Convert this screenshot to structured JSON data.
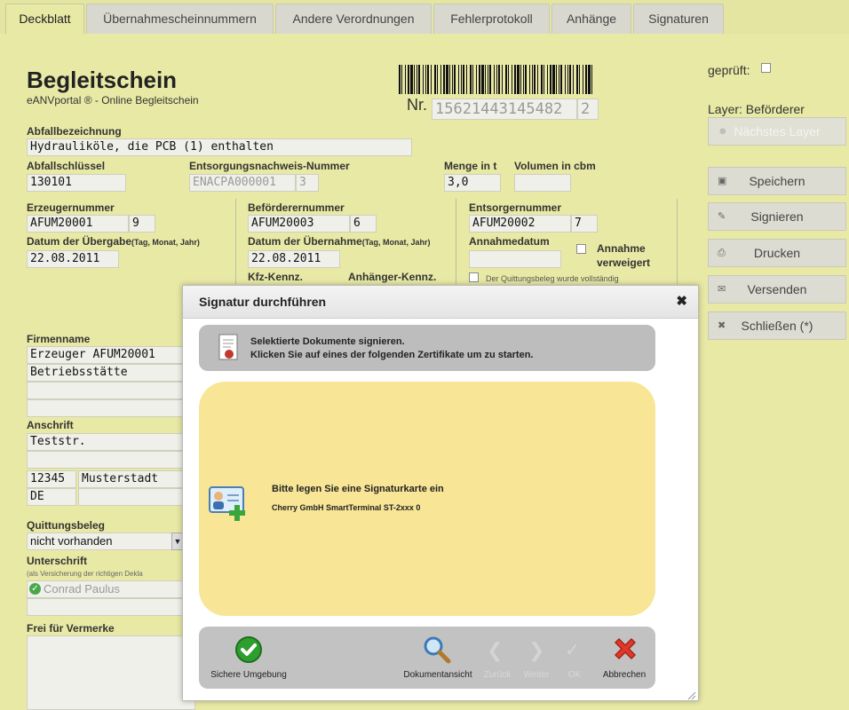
{
  "tabs": [
    "Deckblatt",
    "Übernahmescheinnummern",
    "Andere Verordnungen",
    "Fehlerprotokoll",
    "Anhänge",
    "Signaturen"
  ],
  "header": {
    "title": "Begleitschein",
    "subtitle": "eANVportal ® - Online Begleitschein",
    "nr_label": "Nr.",
    "nr_value": "15621443145482",
    "nr_suffix": "2"
  },
  "right": {
    "geprueft_label": "geprüft:",
    "layer_label": "Layer: Beförderer",
    "next_layer": "Nächstes Layer",
    "buttons": [
      "Speichern",
      "Signieren",
      "Drucken",
      "Versenden",
      "Schließen (*)"
    ]
  },
  "form": {
    "abfall_label": "Abfallbezeichnung",
    "abfall_value": "Hydrauliköle, die PCB (1) enthalten",
    "schluessel_label": "Abfallschlüssel",
    "schluessel_value": "130101",
    "nachweis_label": "Entsorgungsnachweis-Nummer",
    "nachweis_value": "ENACPA000001",
    "nachweis_suffix": "3",
    "menge_label": "Menge in t",
    "menge_value": "3,0",
    "volumen_label": "Volumen in cbm",
    "volumen_value": "",
    "erzeuger_label": "Erzeugernummer",
    "erzeuger_value": "AFUM20001",
    "erzeuger_suffix": "9",
    "uebergabe_label": "Datum der Übergabe",
    "uebergabe_small": "(Tag, Monat, Jahr)",
    "uebergabe_value": "22.08.2011",
    "befoerderer_label": "Beförderernummer",
    "befoerderer_value": "AFUM20003",
    "befoerderer_suffix": "6",
    "uebernahme_label": "Datum der Übernahme",
    "uebernahme_small": "(Tag, Monat, Jahr)",
    "uebernahme_value": "22.08.2011",
    "kfz_label": "Kfz-Kennz.",
    "anhaenger_label": "Anhänger-Kennz.",
    "entsorger_label": "Entsorgernummer",
    "entsorger_value": "AFUM20002",
    "entsorger_suffix": "7",
    "annahme_label": "Annahmedatum",
    "annahme_verweigert": "Annahme verweigert",
    "quittung_text": "Der Quittungsbeleg wurde vollständig",
    "firmenname_label": "Firmenname",
    "firmenname_value": "Erzeuger AFUM20001",
    "betriebsstaette_value": "Betriebsstätte",
    "anschrift_label": "Anschrift",
    "strasse_value": "Teststr.",
    "plz_value": "12345",
    "ort_value": "Musterstadt",
    "land_value": "DE",
    "quittungsbeleg_label": "Quittungsbeleg",
    "quittungsbeleg_value": "nicht vorhanden",
    "unterschrift_label": "Unterschrift",
    "unterschrift_small": "(als Versicherung der richtigen Dekla",
    "unterschrift_value": "Conrad Paulus",
    "vermerke_label": "Frei für Vermerke"
  },
  "dialog": {
    "title": "Signatur durchführen",
    "info_line1": "Selektierte Dokumente signieren.",
    "info_line2": "Klicken Sie auf eines der folgenden Zertifikate um zu starten.",
    "card_line1": "Bitte legen Sie eine Signaturkarte ein",
    "card_line2": "Cherry GmbH SmartTerminal ST-2xxx 0",
    "sichere_umgebung": "Sichere Umgebung",
    "dokumentansicht": "Dokumentansicht",
    "zurueck": "Zurück",
    "weiter": "Weiter",
    "ok": "OK",
    "abbrechen": "Abbrechen"
  },
  "colors": {
    "background": "#e8e9a5",
    "dialog_card": "#f8e596",
    "ok_green": "#2e9e2e",
    "cancel_red": "#e0392b"
  }
}
